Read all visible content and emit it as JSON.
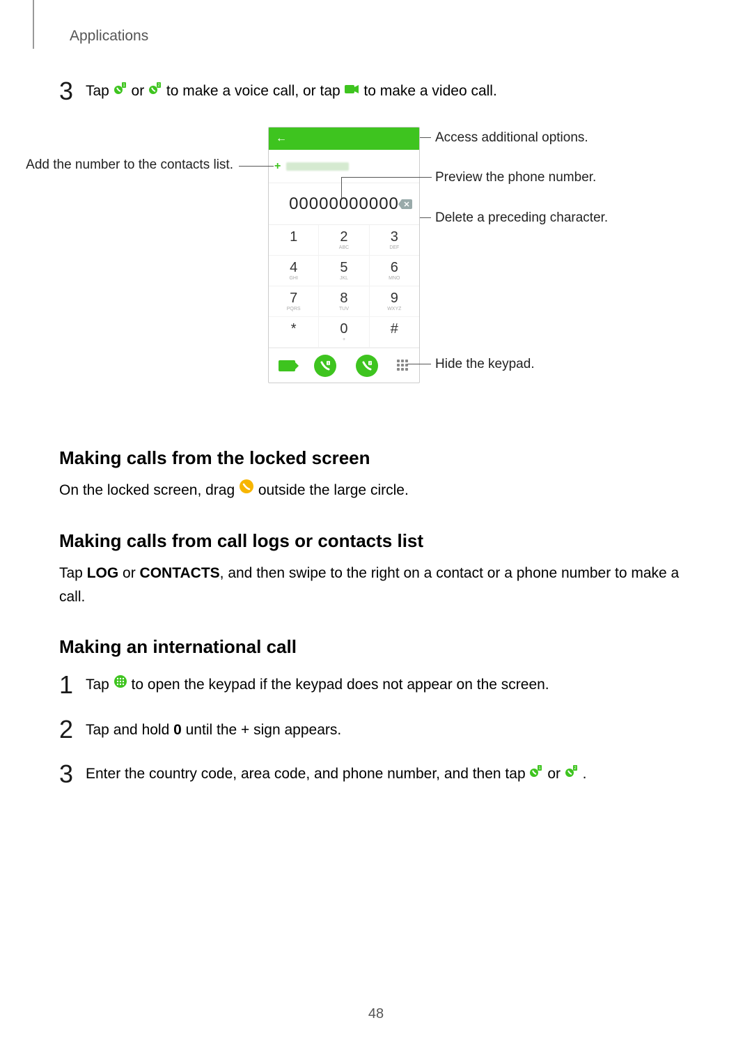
{
  "header": "Applications",
  "page_number": "48",
  "step3": {
    "num": "3",
    "t1": "Tap ",
    "t2": " or ",
    "t3": " to make a voice call, or tap ",
    "t4": " to make a video call."
  },
  "callouts": {
    "add_contacts": "Add the number to the contacts list.",
    "access_options": "Access additional options.",
    "preview": "Preview the phone number.",
    "delete": "Delete a preceding character.",
    "hide_keypad": "Hide the keypad."
  },
  "phone": {
    "display_number": "00000000000",
    "keys": [
      "1",
      "2",
      "3",
      "4",
      "5",
      "6",
      "7",
      "8",
      "9",
      "*",
      "0",
      "#"
    ],
    "sub": [
      "ABC",
      "DEF",
      "GHI",
      "JKL",
      "MNO",
      "PQRS",
      "TUV",
      "WXYZ"
    ],
    "zero_sub": "+"
  },
  "sections": {
    "locked_title": "Making calls from the locked screen",
    "locked_para_a": "On the locked screen, drag ",
    "locked_para_b": " outside the large circle.",
    "logs_title": "Making calls from call logs or contacts list",
    "logs_para_a": "Tap ",
    "logs_log": "LOG",
    "logs_or": " or ",
    "logs_contacts": "CONTACTS",
    "logs_para_b": ", and then swipe to the right on a contact or a phone number to make a call.",
    "intl_title": "Making an international call"
  },
  "intl_steps": {
    "s1_num": "1",
    "s1_a": "Tap ",
    "s1_b": " to open the keypad if the keypad does not appear on the screen.",
    "s2_num": "2",
    "s2_a": "Tap and hold ",
    "s2_zero": "0",
    "s2_b": " until the + sign appears.",
    "s3_num": "3",
    "s3_a": "Enter the country code, area code, and phone number, and then tap ",
    "s3_or": " or ",
    "s3_end": "."
  }
}
